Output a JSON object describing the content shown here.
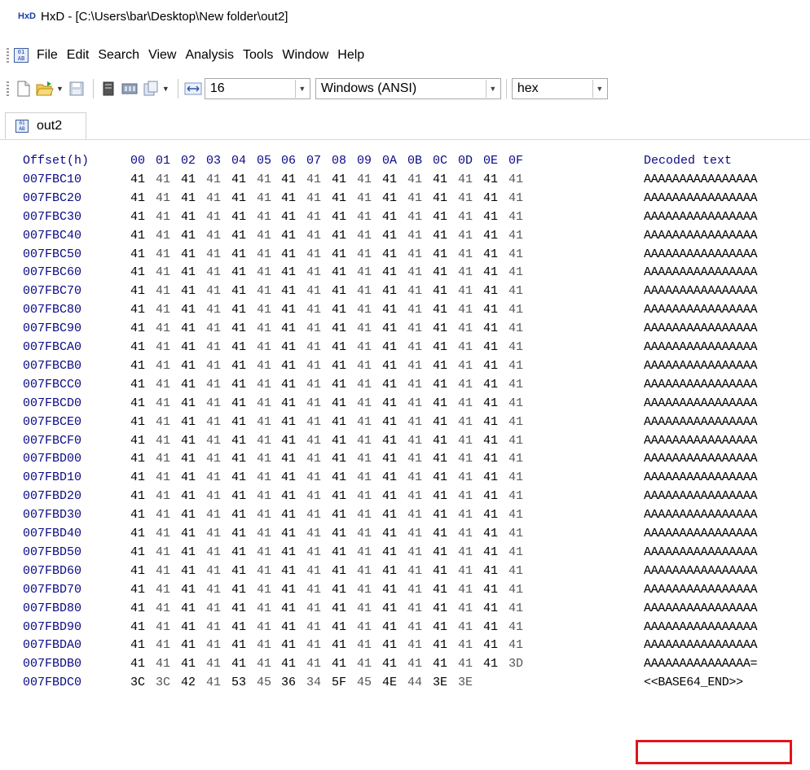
{
  "window": {
    "title": "HxD - [C:\\Users\\bar\\Desktop\\New folder\\out2]"
  },
  "menu": [
    "File",
    "Edit",
    "Search",
    "View",
    "Analysis",
    "Tools",
    "Window",
    "Help"
  ],
  "toolbar": {
    "icons": [
      "new-file-icon",
      "open-file-icon",
      "save-icon",
      "open-disk-icon",
      "open-ram-icon",
      "copy-data-icon"
    ],
    "bytes_per_row": "16",
    "charset": "Windows (ANSI)",
    "offset_base": "hex"
  },
  "tab": {
    "label": "out2"
  },
  "hex": {
    "header_offset": "Offset(h)",
    "header_cols": [
      "00",
      "01",
      "02",
      "03",
      "04",
      "05",
      "06",
      "07",
      "08",
      "09",
      "0A",
      "0B",
      "0C",
      "0D",
      "0E",
      "0F"
    ],
    "header_text": "Decoded text",
    "rows": [
      {
        "offset": "007FBC10",
        "bytes": [
          "41",
          "41",
          "41",
          "41",
          "41",
          "41",
          "41",
          "41",
          "41",
          "41",
          "41",
          "41",
          "41",
          "41",
          "41",
          "41"
        ],
        "text": "AAAAAAAAAAAAAAAA"
      },
      {
        "offset": "007FBC20",
        "bytes": [
          "41",
          "41",
          "41",
          "41",
          "41",
          "41",
          "41",
          "41",
          "41",
          "41",
          "41",
          "41",
          "41",
          "41",
          "41",
          "41"
        ],
        "text": "AAAAAAAAAAAAAAAA"
      },
      {
        "offset": "007FBC30",
        "bytes": [
          "41",
          "41",
          "41",
          "41",
          "41",
          "41",
          "41",
          "41",
          "41",
          "41",
          "41",
          "41",
          "41",
          "41",
          "41",
          "41"
        ],
        "text": "AAAAAAAAAAAAAAAA"
      },
      {
        "offset": "007FBC40",
        "bytes": [
          "41",
          "41",
          "41",
          "41",
          "41",
          "41",
          "41",
          "41",
          "41",
          "41",
          "41",
          "41",
          "41",
          "41",
          "41",
          "41"
        ],
        "text": "AAAAAAAAAAAAAAAA"
      },
      {
        "offset": "007FBC50",
        "bytes": [
          "41",
          "41",
          "41",
          "41",
          "41",
          "41",
          "41",
          "41",
          "41",
          "41",
          "41",
          "41",
          "41",
          "41",
          "41",
          "41"
        ],
        "text": "AAAAAAAAAAAAAAAA"
      },
      {
        "offset": "007FBC60",
        "bytes": [
          "41",
          "41",
          "41",
          "41",
          "41",
          "41",
          "41",
          "41",
          "41",
          "41",
          "41",
          "41",
          "41",
          "41",
          "41",
          "41"
        ],
        "text": "AAAAAAAAAAAAAAAA"
      },
      {
        "offset": "007FBC70",
        "bytes": [
          "41",
          "41",
          "41",
          "41",
          "41",
          "41",
          "41",
          "41",
          "41",
          "41",
          "41",
          "41",
          "41",
          "41",
          "41",
          "41"
        ],
        "text": "AAAAAAAAAAAAAAAA"
      },
      {
        "offset": "007FBC80",
        "bytes": [
          "41",
          "41",
          "41",
          "41",
          "41",
          "41",
          "41",
          "41",
          "41",
          "41",
          "41",
          "41",
          "41",
          "41",
          "41",
          "41"
        ],
        "text": "AAAAAAAAAAAAAAAA"
      },
      {
        "offset": "007FBC90",
        "bytes": [
          "41",
          "41",
          "41",
          "41",
          "41",
          "41",
          "41",
          "41",
          "41",
          "41",
          "41",
          "41",
          "41",
          "41",
          "41",
          "41"
        ],
        "text": "AAAAAAAAAAAAAAAA"
      },
      {
        "offset": "007FBCA0",
        "bytes": [
          "41",
          "41",
          "41",
          "41",
          "41",
          "41",
          "41",
          "41",
          "41",
          "41",
          "41",
          "41",
          "41",
          "41",
          "41",
          "41"
        ],
        "text": "AAAAAAAAAAAAAAAA"
      },
      {
        "offset": "007FBCB0",
        "bytes": [
          "41",
          "41",
          "41",
          "41",
          "41",
          "41",
          "41",
          "41",
          "41",
          "41",
          "41",
          "41",
          "41",
          "41",
          "41",
          "41"
        ],
        "text": "AAAAAAAAAAAAAAAA"
      },
      {
        "offset": "007FBCC0",
        "bytes": [
          "41",
          "41",
          "41",
          "41",
          "41",
          "41",
          "41",
          "41",
          "41",
          "41",
          "41",
          "41",
          "41",
          "41",
          "41",
          "41"
        ],
        "text": "AAAAAAAAAAAAAAAA"
      },
      {
        "offset": "007FBCD0",
        "bytes": [
          "41",
          "41",
          "41",
          "41",
          "41",
          "41",
          "41",
          "41",
          "41",
          "41",
          "41",
          "41",
          "41",
          "41",
          "41",
          "41"
        ],
        "text": "AAAAAAAAAAAAAAAA"
      },
      {
        "offset": "007FBCE0",
        "bytes": [
          "41",
          "41",
          "41",
          "41",
          "41",
          "41",
          "41",
          "41",
          "41",
          "41",
          "41",
          "41",
          "41",
          "41",
          "41",
          "41"
        ],
        "text": "AAAAAAAAAAAAAAAA"
      },
      {
        "offset": "007FBCF0",
        "bytes": [
          "41",
          "41",
          "41",
          "41",
          "41",
          "41",
          "41",
          "41",
          "41",
          "41",
          "41",
          "41",
          "41",
          "41",
          "41",
          "41"
        ],
        "text": "AAAAAAAAAAAAAAAA"
      },
      {
        "offset": "007FBD00",
        "bytes": [
          "41",
          "41",
          "41",
          "41",
          "41",
          "41",
          "41",
          "41",
          "41",
          "41",
          "41",
          "41",
          "41",
          "41",
          "41",
          "41"
        ],
        "text": "AAAAAAAAAAAAAAAA"
      },
      {
        "offset": "007FBD10",
        "bytes": [
          "41",
          "41",
          "41",
          "41",
          "41",
          "41",
          "41",
          "41",
          "41",
          "41",
          "41",
          "41",
          "41",
          "41",
          "41",
          "41"
        ],
        "text": "AAAAAAAAAAAAAAAA"
      },
      {
        "offset": "007FBD20",
        "bytes": [
          "41",
          "41",
          "41",
          "41",
          "41",
          "41",
          "41",
          "41",
          "41",
          "41",
          "41",
          "41",
          "41",
          "41",
          "41",
          "41"
        ],
        "text": "AAAAAAAAAAAAAAAA"
      },
      {
        "offset": "007FBD30",
        "bytes": [
          "41",
          "41",
          "41",
          "41",
          "41",
          "41",
          "41",
          "41",
          "41",
          "41",
          "41",
          "41",
          "41",
          "41",
          "41",
          "41"
        ],
        "text": "AAAAAAAAAAAAAAAA"
      },
      {
        "offset": "007FBD40",
        "bytes": [
          "41",
          "41",
          "41",
          "41",
          "41",
          "41",
          "41",
          "41",
          "41",
          "41",
          "41",
          "41",
          "41",
          "41",
          "41",
          "41"
        ],
        "text": "AAAAAAAAAAAAAAAA"
      },
      {
        "offset": "007FBD50",
        "bytes": [
          "41",
          "41",
          "41",
          "41",
          "41",
          "41",
          "41",
          "41",
          "41",
          "41",
          "41",
          "41",
          "41",
          "41",
          "41",
          "41"
        ],
        "text": "AAAAAAAAAAAAAAAA"
      },
      {
        "offset": "007FBD60",
        "bytes": [
          "41",
          "41",
          "41",
          "41",
          "41",
          "41",
          "41",
          "41",
          "41",
          "41",
          "41",
          "41",
          "41",
          "41",
          "41",
          "41"
        ],
        "text": "AAAAAAAAAAAAAAAA"
      },
      {
        "offset": "007FBD70",
        "bytes": [
          "41",
          "41",
          "41",
          "41",
          "41",
          "41",
          "41",
          "41",
          "41",
          "41",
          "41",
          "41",
          "41",
          "41",
          "41",
          "41"
        ],
        "text": "AAAAAAAAAAAAAAAA"
      },
      {
        "offset": "007FBD80",
        "bytes": [
          "41",
          "41",
          "41",
          "41",
          "41",
          "41",
          "41",
          "41",
          "41",
          "41",
          "41",
          "41",
          "41",
          "41",
          "41",
          "41"
        ],
        "text": "AAAAAAAAAAAAAAAA"
      },
      {
        "offset": "007FBD90",
        "bytes": [
          "41",
          "41",
          "41",
          "41",
          "41",
          "41",
          "41",
          "41",
          "41",
          "41",
          "41",
          "41",
          "41",
          "41",
          "41",
          "41"
        ],
        "text": "AAAAAAAAAAAAAAAA"
      },
      {
        "offset": "007FBDA0",
        "bytes": [
          "41",
          "41",
          "41",
          "41",
          "41",
          "41",
          "41",
          "41",
          "41",
          "41",
          "41",
          "41",
          "41",
          "41",
          "41",
          "41"
        ],
        "text": "AAAAAAAAAAAAAAAA"
      },
      {
        "offset": "007FBDB0",
        "bytes": [
          "41",
          "41",
          "41",
          "41",
          "41",
          "41",
          "41",
          "41",
          "41",
          "41",
          "41",
          "41",
          "41",
          "41",
          "41",
          "3D"
        ],
        "text": "AAAAAAAAAAAAAAA="
      },
      {
        "offset": "007FBDC0",
        "bytes": [
          "3C",
          "3C",
          "42",
          "41",
          "53",
          "45",
          "36",
          "34",
          "5F",
          "45",
          "4E",
          "44",
          "3E",
          "3E"
        ],
        "text": "<<BASE64_END>>"
      }
    ]
  },
  "colors": {
    "offset_text": "#0a0a86",
    "highlight_border": "#e0151b",
    "tab_border": "#d0d0d0"
  }
}
